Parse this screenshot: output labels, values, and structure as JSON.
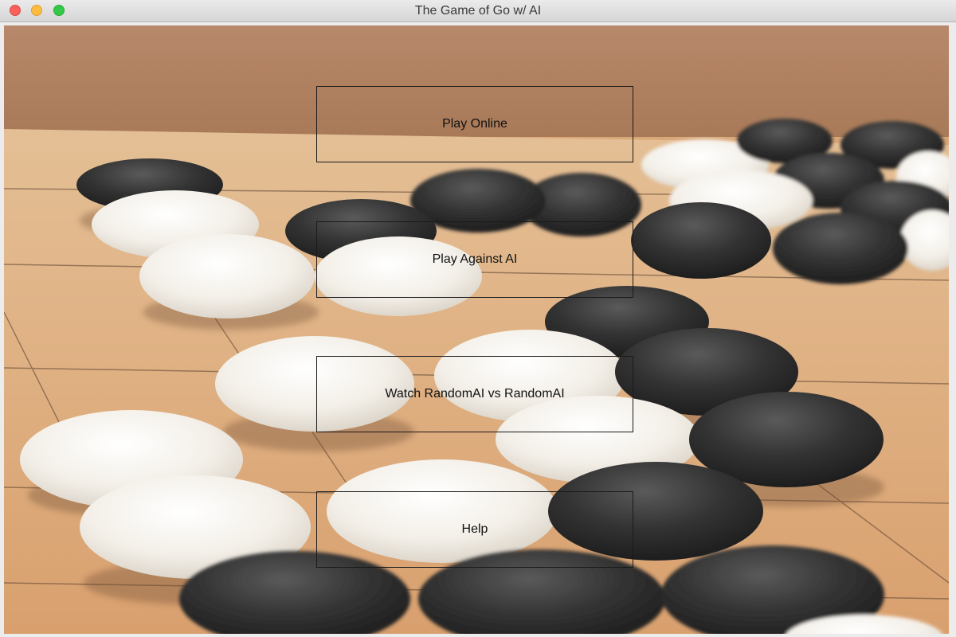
{
  "window": {
    "title": "The Game of Go w/ AI",
    "controls": [
      "close",
      "minimize",
      "maximize"
    ]
  },
  "background": {
    "description_icon": "go-stones-on-board-image",
    "colors": {
      "board": "#dcb487",
      "wall": "#b08360",
      "black_stone": "#2b2b2b",
      "white_stone": "#f1ede6"
    }
  },
  "menu": {
    "play_online": "Play Online",
    "play_against_ai": "Play Against AI",
    "watch_ai": "Watch RandomAI vs RandomAI",
    "help": "Help"
  }
}
